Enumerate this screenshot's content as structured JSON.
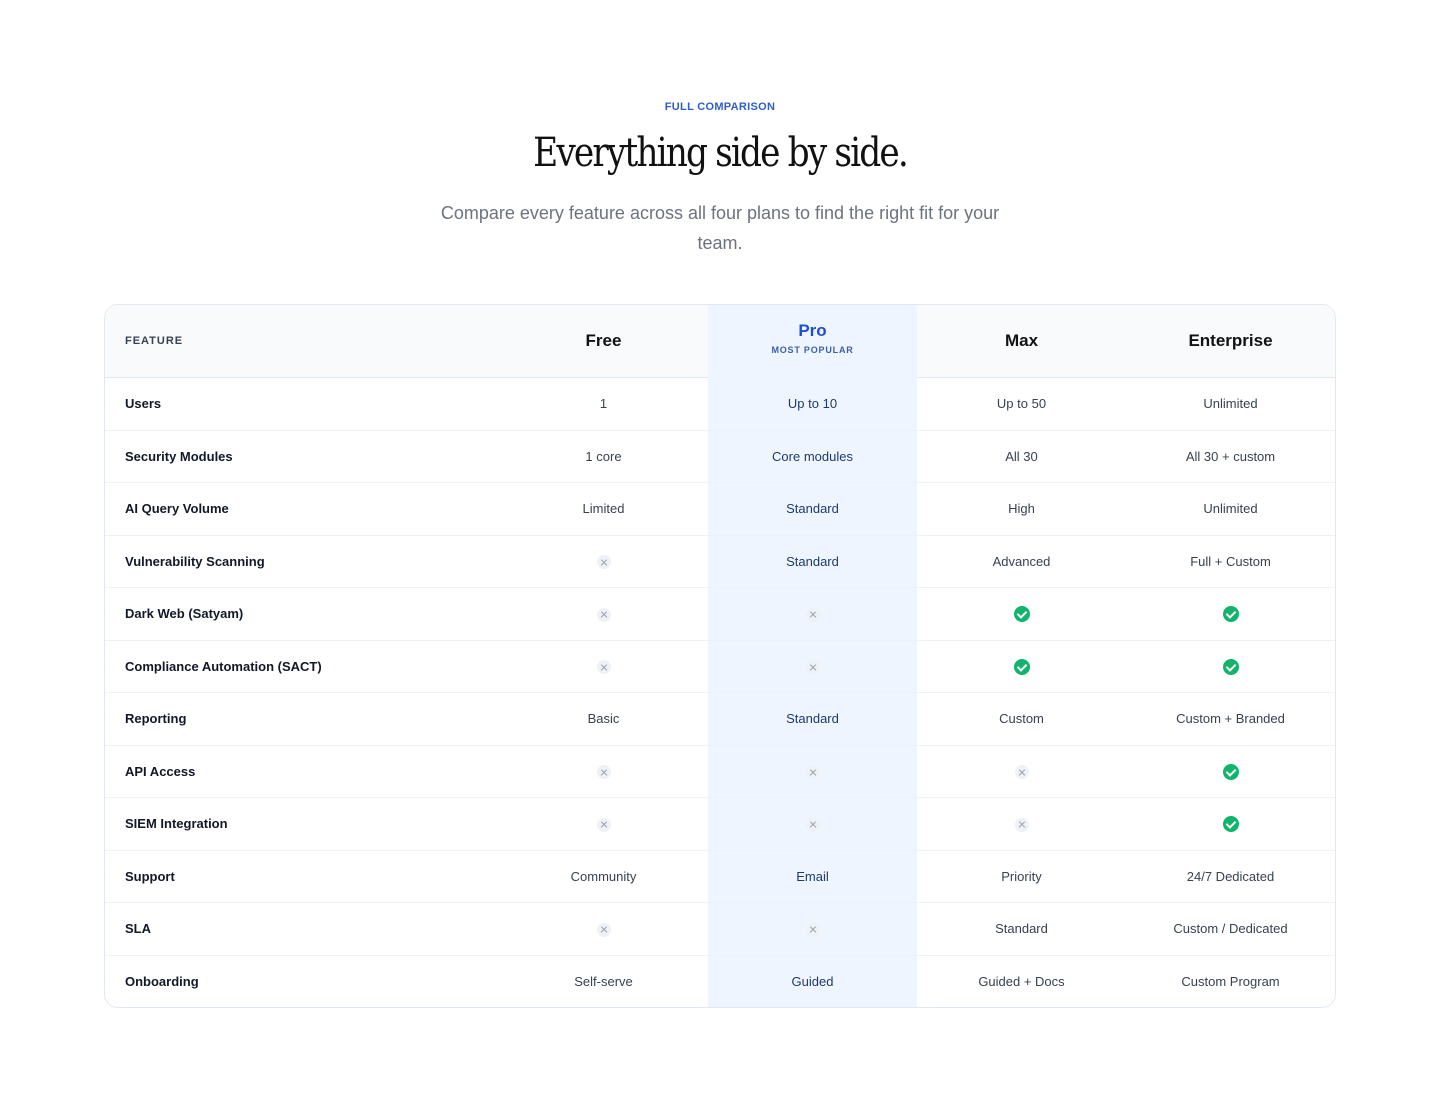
{
  "section": {
    "eyebrow": "FULL COMPARISON",
    "title": "Everything side by side.",
    "subtitle": "Compare every feature across all four plans to find the right fit for your team."
  },
  "table": {
    "feature_header": "FEATURE",
    "plans": [
      {
        "name": "Free",
        "badge": ""
      },
      {
        "name": "Pro",
        "badge": "MOST POPULAR"
      },
      {
        "name": "Max",
        "badge": ""
      },
      {
        "name": "Enterprise",
        "badge": ""
      }
    ],
    "rows": [
      {
        "feature": "Users",
        "values": [
          "1",
          "Up to 10",
          "Up to 50",
          "Unlimited"
        ]
      },
      {
        "feature": "Security Modules",
        "values": [
          "1 core",
          "Core modules",
          "All 30",
          "All 30 + custom"
        ]
      },
      {
        "feature": "AI Query Volume",
        "values": [
          "Limited",
          "Standard",
          "High",
          "Unlimited"
        ]
      },
      {
        "feature": "Vulnerability Scanning",
        "values": [
          "x-icon",
          "Standard",
          "Advanced",
          "Full + Custom"
        ]
      },
      {
        "feature": "Dark Web (Satyam)",
        "values": [
          "x-icon",
          "x-icon",
          "check-icon",
          "check-icon"
        ]
      },
      {
        "feature": "Compliance Automation (SACT)",
        "values": [
          "x-icon",
          "x-icon",
          "check-icon",
          "check-icon"
        ]
      },
      {
        "feature": "Reporting",
        "values": [
          "Basic",
          "Standard",
          "Custom",
          "Custom + Branded"
        ]
      },
      {
        "feature": "API Access",
        "values": [
          "x-icon",
          "x-icon",
          "x-icon",
          "check-icon"
        ]
      },
      {
        "feature": "SIEM Integration",
        "values": [
          "x-icon",
          "x-icon",
          "x-icon",
          "check-icon"
        ]
      },
      {
        "feature": "Support",
        "values": [
          "Community",
          "Email",
          "Priority",
          "24/7 Dedicated"
        ]
      },
      {
        "feature": "SLA",
        "values": [
          "x-icon",
          "x-icon",
          "Standard",
          "Custom / Dedicated"
        ]
      },
      {
        "feature": "Onboarding",
        "values": [
          "Self-serve",
          "Guided",
          "Guided + Docs",
          "Custom Program"
        ]
      }
    ]
  },
  "colors": {
    "accent": "#2f5fc4",
    "pro_highlight": "#eef5fe",
    "check": "#10b46a"
  }
}
